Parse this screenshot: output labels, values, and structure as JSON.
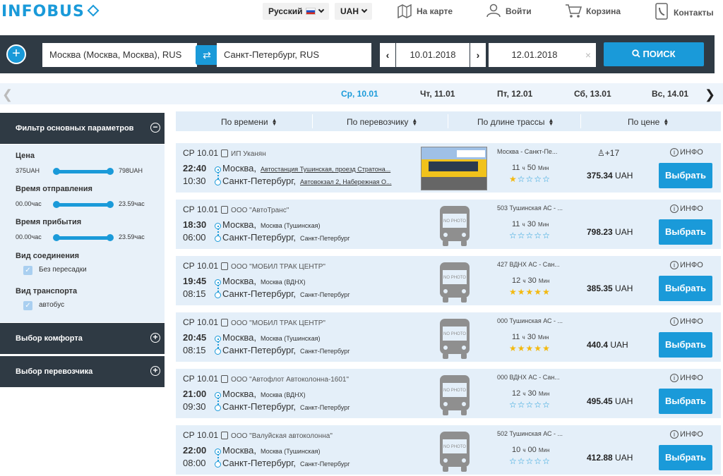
{
  "header": {
    "logo": "INFOBUS",
    "language": "Русский",
    "currency": "UAH",
    "nav": {
      "map": "На карте",
      "login": "Войти",
      "cart": "Корзина",
      "contacts": "Контакты"
    }
  },
  "search": {
    "from": "Москва (Москва,  Москва), RUS",
    "to": "Санкт-Петербург, RUS",
    "date_from": "10.01.2018",
    "date_to": "12.01.2018",
    "search_label": "ПОИСК",
    "clear": "×"
  },
  "date_strip": [
    {
      "label": "Ср, 10.01",
      "active": true
    },
    {
      "label": "Чт, 11.01"
    },
    {
      "label": "Пт, 12.01"
    },
    {
      "label": "Сб, 13.01"
    },
    {
      "label": "Вс, 14.01"
    }
  ],
  "sidebar": {
    "filter_title": "Фильтр основных параметров",
    "price_label": "Цена",
    "price_min": "375UAH",
    "price_max": "798UAH",
    "dep_label": "Время отправления",
    "dep_min": "00.00час",
    "dep_max": "23.59час",
    "arr_label": "Время прибытия",
    "arr_min": "00.00час",
    "arr_max": "23.59час",
    "conn_label": "Вид соединения",
    "conn_opt": "Без пересадки",
    "transport_label": "Вид транспорта",
    "transport_opt": "автобус",
    "comfort_title": "Выбор комфорта",
    "carrier_title": "Выбор перевозчика"
  },
  "sort": {
    "time": "По времени",
    "carrier": "По перевозчику",
    "length": "По длине трассы",
    "price": "По цене"
  },
  "trips": [
    {
      "date": "СР 10.01",
      "carrier": "ИП Уканян",
      "dep": "22:40",
      "arr": "10:30",
      "from_city": "Москва,",
      "from_stop": "Автостанция Тушинская, проезд Стратона...",
      "to_city": "Санкт-Петербург,",
      "to_stop": "Автовокзал 2, Набережная О...",
      "route": "Москва - Санкт-Пе...",
      "dur_h": "11",
      "dur_m": "50",
      "rating": 1,
      "seats": "+17",
      "price": "375.34",
      "currency": "UAH",
      "has_photo": true,
      "underline": true
    },
    {
      "date": "СР 10.01",
      "carrier": "ООО \"АвтоТранс\"",
      "dep": "18:30",
      "arr": "06:00",
      "from_city": "Москва,",
      "from_stop": "Москва (Тушинская)",
      "to_city": "Санкт-Петербург,",
      "to_stop": "Санкт-Петербург",
      "route": "503 Тушинская АС - ...",
      "dur_h": "11",
      "dur_m": "30",
      "rating": 0,
      "seats": "",
      "price": "798.23",
      "currency": "UAH",
      "has_photo": false
    },
    {
      "date": "СР 10.01",
      "carrier": "ООО \"МОБИЛ ТРАК ЦЕНТР\"",
      "dep": "19:45",
      "arr": "08:15",
      "from_city": "Москва,",
      "from_stop": "Москва (ВДНХ)",
      "to_city": "Санкт-Петербург,",
      "to_stop": "Санкт-Петербург",
      "route": "427 ВДНХ АС - Сан...",
      "dur_h": "12",
      "dur_m": "30",
      "rating": 5,
      "seats": "",
      "price": "385.35",
      "currency": "UAH",
      "has_photo": false
    },
    {
      "date": "СР 10.01",
      "carrier": "ООО \"МОБИЛ ТРАК ЦЕНТР\"",
      "dep": "20:45",
      "arr": "08:15",
      "from_city": "Москва,",
      "from_stop": "Москва (Тушинская)",
      "to_city": "Санкт-Петербург,",
      "to_stop": "Санкт-Петербург",
      "route": "000 Тушинская АС - ...",
      "dur_h": "11",
      "dur_m": "30",
      "rating": 5,
      "seats": "",
      "price": "440.4",
      "currency": "UAH",
      "has_photo": false
    },
    {
      "date": "СР 10.01",
      "carrier": "ООО \"Автофлот Автоколонна-1601\"",
      "dep": "21:00",
      "arr": "09:30",
      "from_city": "Москва,",
      "from_stop": "Москва (ВДНХ)",
      "to_city": "Санкт-Петербург,",
      "to_stop": "Санкт-Петербург",
      "route": "000 ВДНХ АС - Сан...",
      "dur_h": "12",
      "dur_m": "30",
      "rating": 0,
      "seats": "",
      "price": "495.45",
      "currency": "UAH",
      "has_photo": false
    },
    {
      "date": "СР 10.01",
      "carrier": "ООО \"Валуйская автоколонна\"",
      "dep": "22:00",
      "arr": "08:00",
      "from_city": "Москва,",
      "from_stop": "Москва (Тушинская)",
      "to_city": "Санкт-Петербург,",
      "to_stop": "Санкт-Петербург",
      "route": "502 Тушинская АС - ...",
      "dur_h": "10",
      "dur_m": "00",
      "rating": 0,
      "seats": "",
      "price": "412.88",
      "currency": "UAH",
      "has_photo": false
    }
  ],
  "labels": {
    "hours": "ч",
    "minutes": "Мин",
    "info": "ИНФО",
    "select": "Выбрать",
    "no_photo": "NO PHOTO"
  },
  "colors": {
    "accent": "#1a9ad9",
    "dark": "#2f3a44",
    "star": "#f3b90f"
  }
}
